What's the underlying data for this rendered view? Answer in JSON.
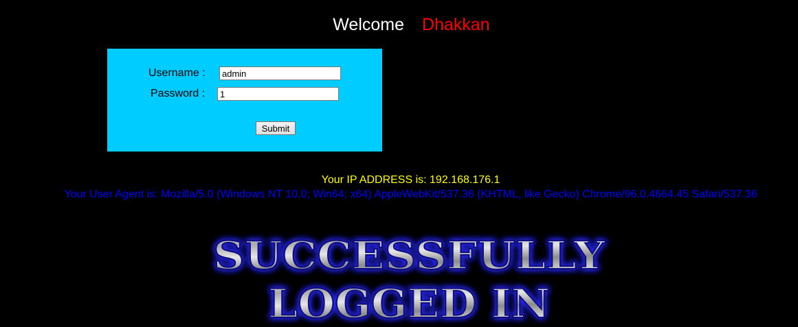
{
  "header": {
    "welcome_text": "Welcome",
    "user_name": "Dhakkan"
  },
  "login_form": {
    "username_label": "Username :",
    "username_value": "admin",
    "password_label": "Password :",
    "password_value": "1",
    "submit_label": "Submit"
  },
  "info": {
    "ip_text": "Your IP ADDRESS is: 192.168.176.1",
    "user_agent_text": "Your User Agent is: Mozilla/5.0 (Windows NT 10.0; Win64; x64) AppleWebKit/537.36 (KHTML, like Gecko) Chrome/96.0.4664.45 Safari/537.36"
  },
  "banner": {
    "line1": "SUCCESSFULLY",
    "line2": "LOGGED IN"
  },
  "colors": {
    "background": "#000000",
    "login_box": "#00ccff",
    "welcome_text": "#ffffff",
    "user_name": "#ff0000",
    "ip_text": "#ffff00",
    "user_agent_text": "#0000ff",
    "banner_glow": "#2a2aff"
  }
}
